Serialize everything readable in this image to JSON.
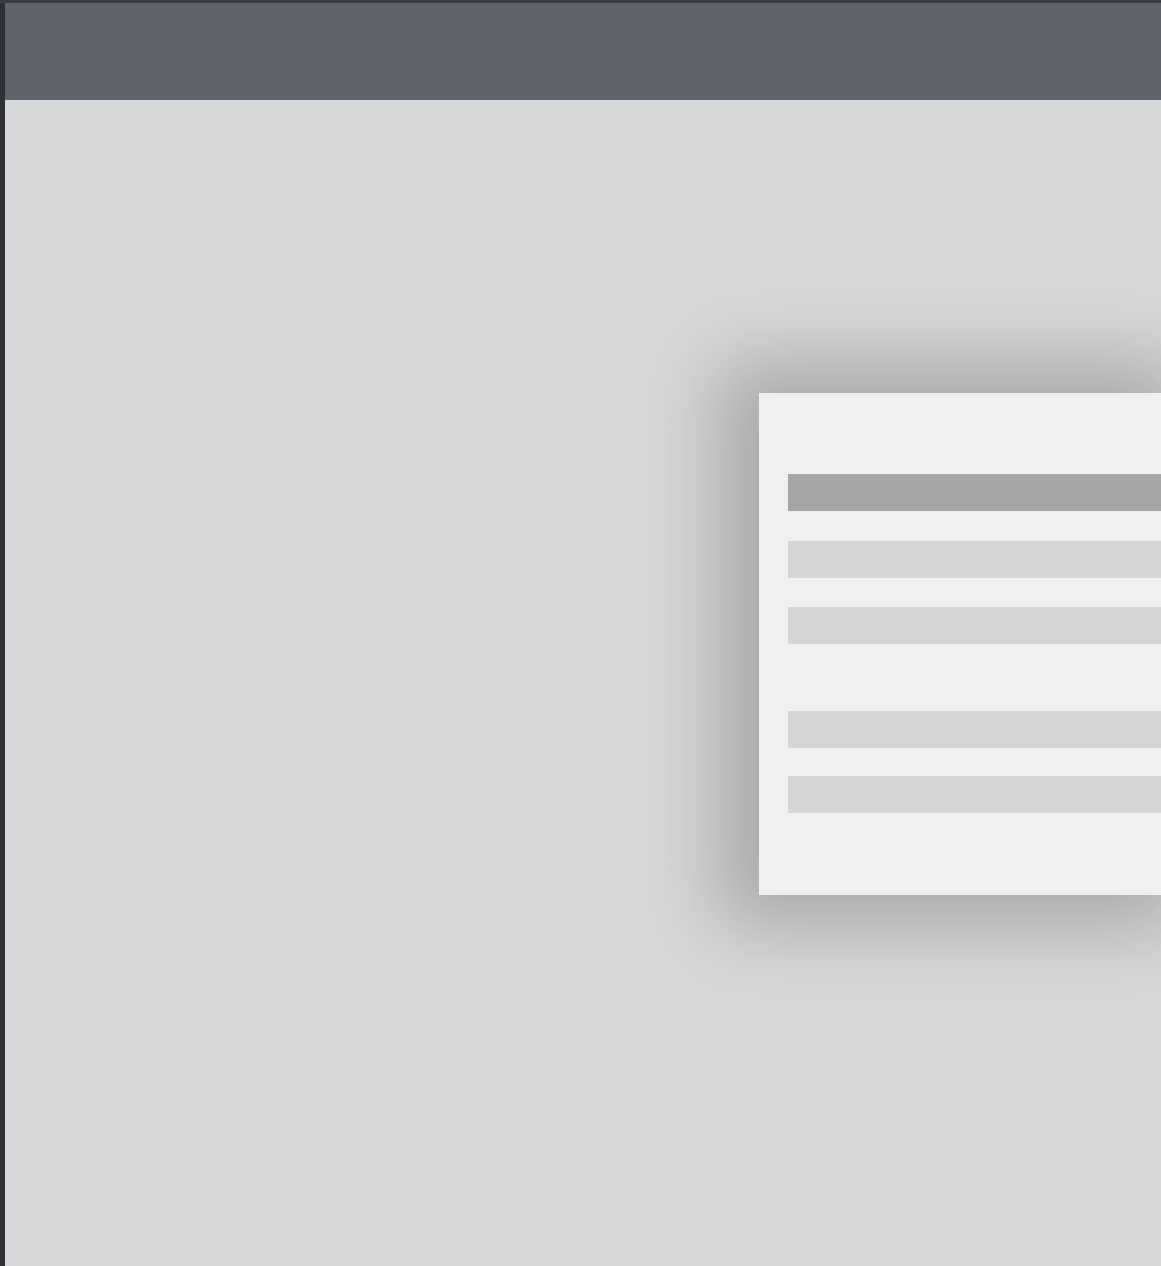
{
  "window": {
    "title": ""
  },
  "panel": {
    "items": [
      {
        "label": "",
        "state": "selected"
      },
      {
        "label": "",
        "state": "normal"
      },
      {
        "label": "",
        "state": "normal"
      },
      {
        "label": "",
        "state": "normal"
      },
      {
        "label": "",
        "state": "normal"
      }
    ]
  },
  "colors": {
    "title_bar": "#5f636c",
    "background": "#d6d7d9",
    "panel": "#f0f0f0",
    "item": "#d4d5d7",
    "item_selected": "#a5a7a7"
  }
}
